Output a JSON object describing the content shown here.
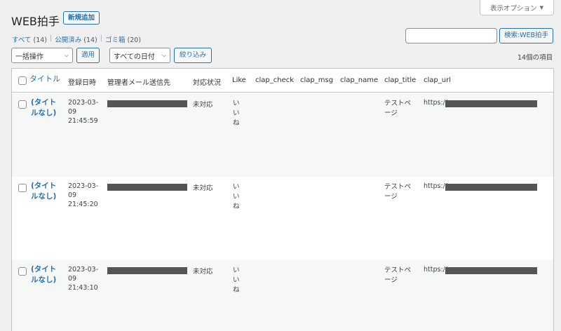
{
  "header": {
    "title": "WEB拍手",
    "add_new": "新規追加",
    "screen_options": "表示オプション"
  },
  "views": [
    {
      "label": "すべて",
      "count": "(14)"
    },
    {
      "label": "公開済み",
      "count": "(14)"
    },
    {
      "label": "ゴミ箱",
      "count": "(20)"
    }
  ],
  "search": {
    "value": "",
    "button": "検索:WEB拍手"
  },
  "tablenav": {
    "bulk_action": "一括操作",
    "apply": "適用",
    "date_filter": "すべての日付",
    "filter": "絞り込み",
    "items_count": "14個の項目"
  },
  "columns": [
    "タイトル",
    "登録日時",
    "管理者メール送信先",
    "対応状況",
    "Like",
    "clap_check",
    "clap_msg",
    "clap_name",
    "clap_title",
    "clap_url"
  ],
  "rows": [
    {
      "title": "(タイトルなし)",
      "date": "2023-03-09",
      "time": "21:45:59",
      "status": "未対応",
      "like": "いいね",
      "clap_title": "テストページ",
      "url_prefix": "https://"
    },
    {
      "title": "(タイトルなし)",
      "date": "2023-03-09",
      "time": "21:45:20",
      "status": "未対応",
      "like": "いいね",
      "clap_title": "テストページ",
      "url_prefix": "https://"
    },
    {
      "title": "(タイトルなし)",
      "date": "2023-03-09",
      "time": "21:43:10",
      "status": "未対応",
      "like": "いいね",
      "clap_title": "テストページ",
      "url_prefix": "https://"
    }
  ],
  "colors": {
    "link": "#2271b1",
    "background": "#f0f0f1",
    "redacted": "#555555"
  }
}
